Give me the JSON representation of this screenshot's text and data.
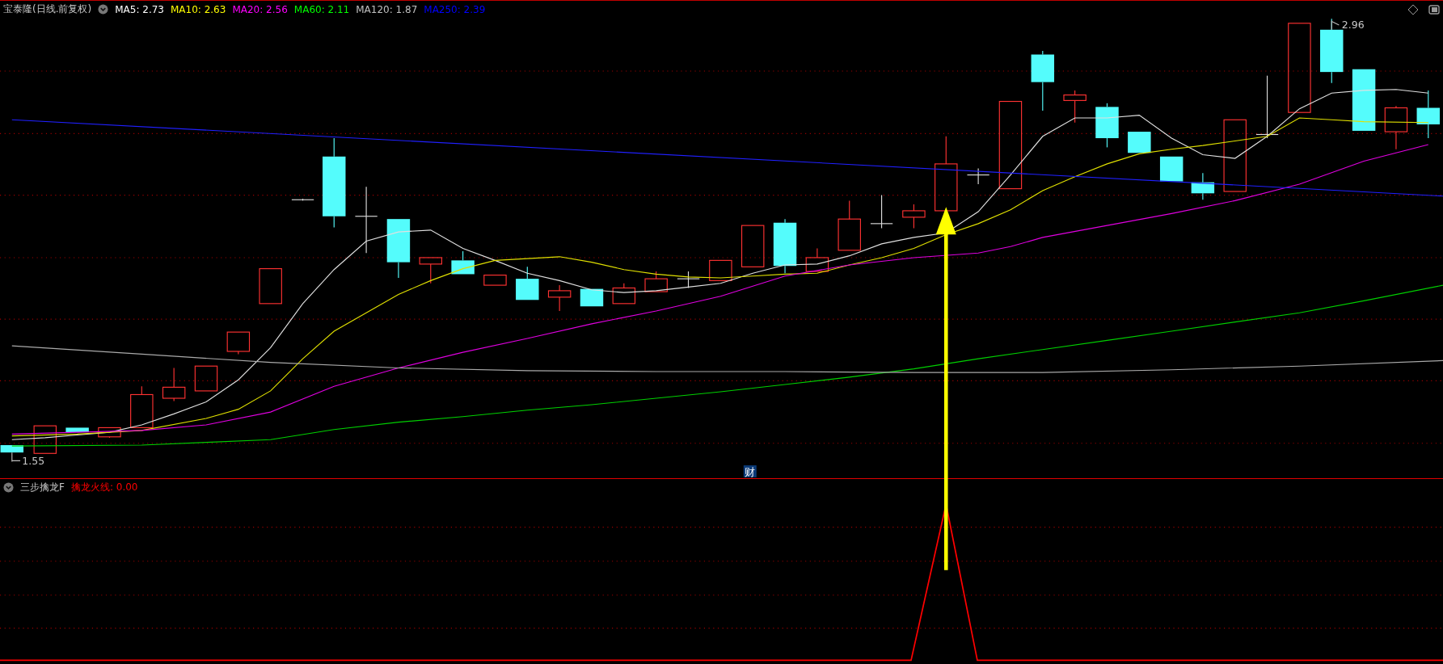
{
  "main_panel": {
    "title": "宝泰隆(日线.前复权)",
    "moving_averages": [
      {
        "label": "MA5: 2.73",
        "color": "#ffffff"
      },
      {
        "label": "MA10: 2.63",
        "color": "#ffff00"
      },
      {
        "label": "MA20: 2.56",
        "color": "#ff00ff"
      },
      {
        "label": "MA60: 2.11",
        "color": "#00ff00"
      },
      {
        "label": "MA120: 1.87",
        "color": "#c0c0c0"
      },
      {
        "label": "MA250: 2.39",
        "color": "#0000ff"
      }
    ],
    "high_label": "2.96",
    "low_label": "1.55",
    "event_marker": "财"
  },
  "indicator_panel": {
    "title": "三步擒龙F",
    "lines": [
      {
        "label": "擒龙火线: 0.00",
        "color": "#ff0000"
      }
    ]
  }
}
